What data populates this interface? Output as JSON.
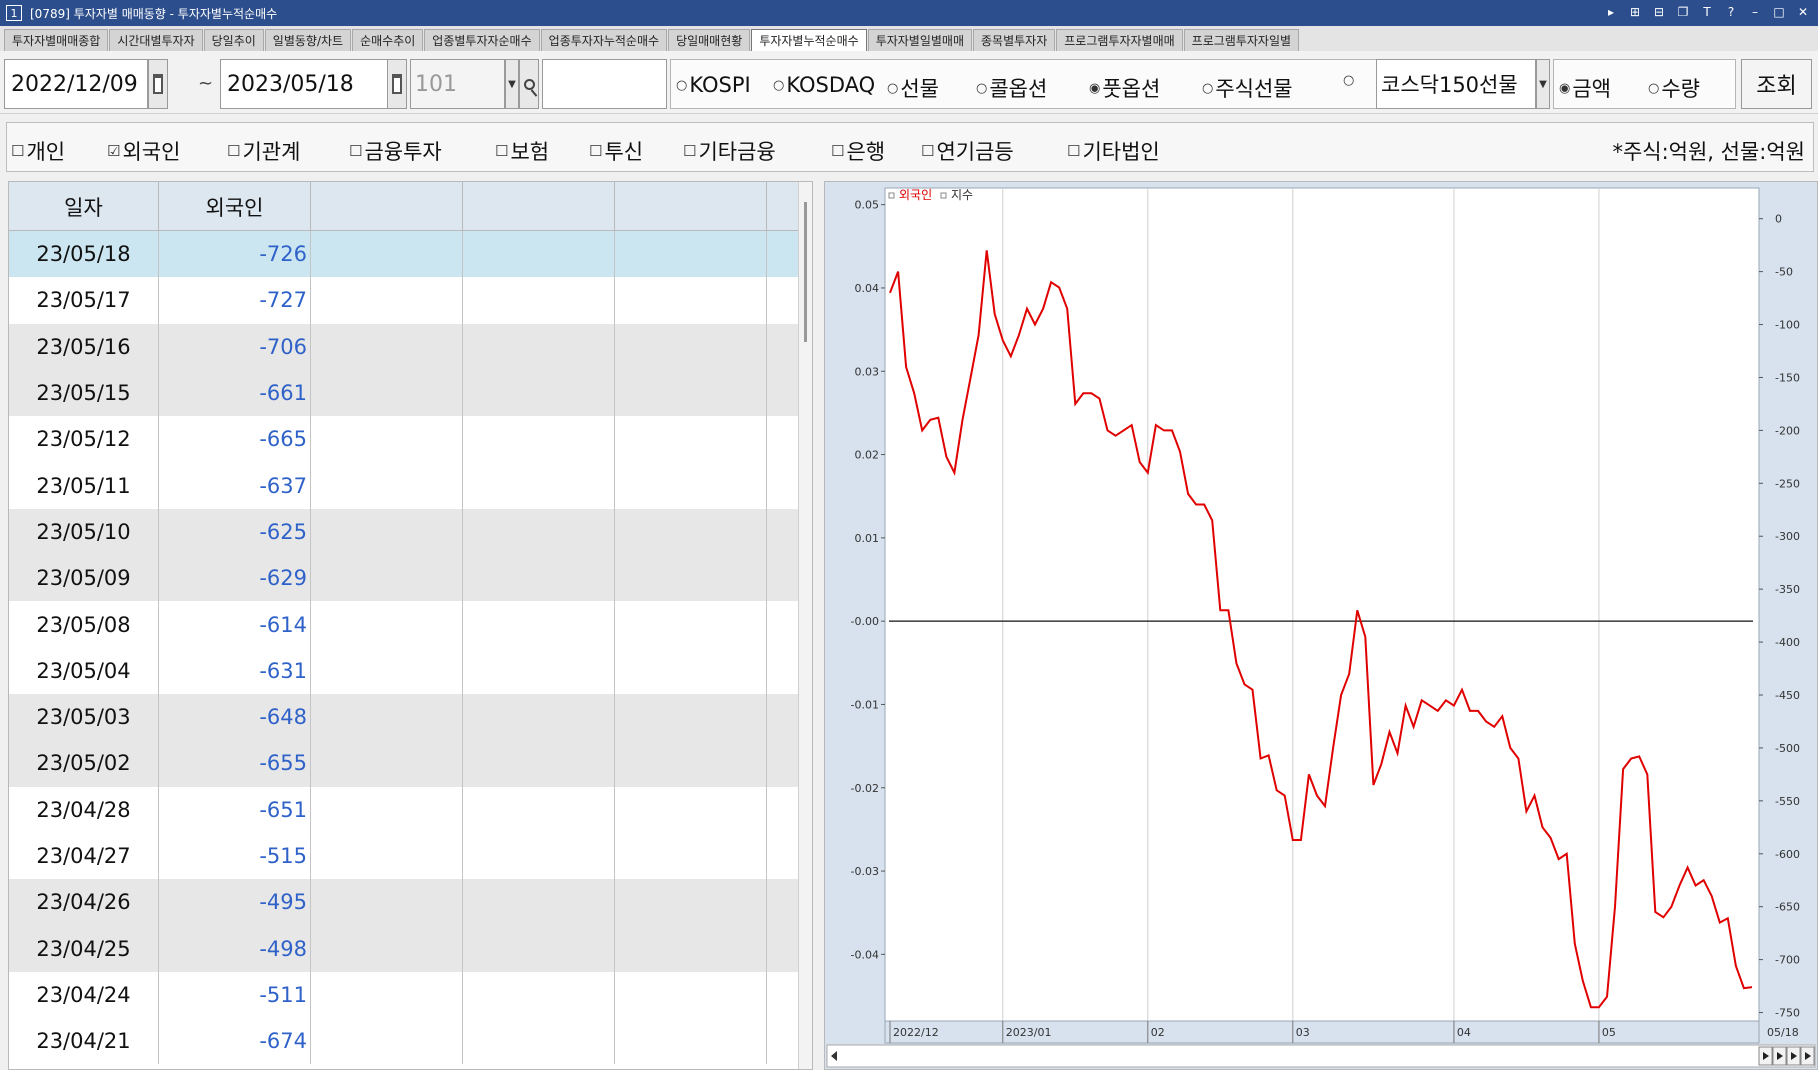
{
  "window": {
    "badge": "1",
    "title": "[0789] 투자자별 매매동향 - 투자자별누적순매수",
    "controls": [
      "▸",
      "⊞",
      "⊟",
      "❐",
      "T",
      "?",
      "–",
      "□",
      "✕"
    ]
  },
  "tabs": [
    {
      "label": "투자자별매매종합",
      "active": false
    },
    {
      "label": "시간대별투자자",
      "active": false
    },
    {
      "label": "당일추이",
      "active": false
    },
    {
      "label": "일별동향/차트",
      "active": false
    },
    {
      "label": "순매수추이",
      "active": false
    },
    {
      "label": "업종별투자자순매수",
      "active": false
    },
    {
      "label": "업종투자자누적순매수",
      "active": false
    },
    {
      "label": "당일매매현황",
      "active": false
    },
    {
      "label": "투자자별누적순매수",
      "active": true
    },
    {
      "label": "투자자별일별매매",
      "active": false
    },
    {
      "label": "종목별투자자",
      "active": false
    },
    {
      "label": "프로그램투자자별매매",
      "active": false
    },
    {
      "label": "프로그램투자자일별",
      "active": false
    }
  ],
  "toolbar": {
    "start_date": "2022/12/09",
    "tilde": "~",
    "end_date": "2023/05/18",
    "code": "101",
    "market_radios": [
      {
        "label": "KOSPI",
        "checked": false
      },
      {
        "label": "KOSDAQ",
        "checked": false
      },
      {
        "label": "선물",
        "checked": false
      },
      {
        "label": "콜옵션",
        "checked": false
      },
      {
        "label": "풋옵션",
        "checked": true
      },
      {
        "label": "주식선물",
        "checked": false
      },
      {
        "label": "",
        "checked": false
      }
    ],
    "product_select": "코스닥150선물",
    "type_radios": [
      {
        "label": "금액",
        "checked": true
      },
      {
        "label": "수량",
        "checked": false
      }
    ],
    "query_label": "조회"
  },
  "investor_checks": [
    {
      "label": "개인",
      "checked": false
    },
    {
      "label": "외국인",
      "checked": true
    },
    {
      "label": "기관계",
      "checked": false
    },
    {
      "label": "금융투자",
      "checked": false
    },
    {
      "label": "보험",
      "checked": false
    },
    {
      "label": "투신",
      "checked": false
    },
    {
      "label": "기타금융",
      "checked": false
    },
    {
      "label": "은행",
      "checked": false
    },
    {
      "label": "연기금등",
      "checked": false
    },
    {
      "label": "기타법인",
      "checked": false
    }
  ],
  "unit_text": "*주식:억원,  선물:억원",
  "grid": {
    "headers": [
      "일자",
      "외국인",
      "",
      "",
      "",
      ""
    ],
    "rows": [
      {
        "date": "23/05/18",
        "value": "-726"
      },
      {
        "date": "23/05/17",
        "value": "-727"
      },
      {
        "date": "23/05/16",
        "value": "-706"
      },
      {
        "date": "23/05/15",
        "value": "-661"
      },
      {
        "date": "23/05/12",
        "value": "-665"
      },
      {
        "date": "23/05/11",
        "value": "-637"
      },
      {
        "date": "23/05/10",
        "value": "-625"
      },
      {
        "date": "23/05/09",
        "value": "-629"
      },
      {
        "date": "23/05/08",
        "value": "-614"
      },
      {
        "date": "23/05/04",
        "value": "-631"
      },
      {
        "date": "23/05/03",
        "value": "-648"
      },
      {
        "date": "23/05/02",
        "value": "-655"
      },
      {
        "date": "23/04/28",
        "value": "-651"
      },
      {
        "date": "23/04/27",
        "value": "-515"
      },
      {
        "date": "23/04/26",
        "value": "-495"
      },
      {
        "date": "23/04/25",
        "value": "-498"
      },
      {
        "date": "23/04/24",
        "value": "-511"
      },
      {
        "date": "23/04/21",
        "value": "-674"
      }
    ]
  },
  "chart_data": {
    "type": "line",
    "legend": [
      {
        "name": "외국인",
        "color": "#e00000"
      },
      {
        "name": "지수",
        "color": "#333333"
      }
    ],
    "left_axis": {
      "ticks": [
        "0.05",
        "0.04",
        "0.03",
        "0.02",
        "0.01",
        "-0.00",
        "-0.01",
        "-0.02",
        "-0.03",
        "-0.04"
      ],
      "range": [
        -0.048,
        0.052
      ]
    },
    "right_axis": {
      "ticks": [
        "0",
        "-50",
        "-100",
        "-150",
        "-200",
        "-250",
        "-300",
        "-350",
        "-400",
        "-450",
        "-500",
        "-550",
        "-600",
        "-650",
        "-700",
        "-750"
      ],
      "range": [
        -758,
        29
      ]
    },
    "x_labels": [
      {
        "label": "2022/12",
        "index": 0
      },
      {
        "label": "2023/01",
        "index": 14
      },
      {
        "label": "02",
        "index": 32
      },
      {
        "label": "03",
        "index": 50
      },
      {
        "label": "04",
        "index": 70
      },
      {
        "label": "05",
        "index": 88
      }
    ],
    "x_end_label": "05/18",
    "zero_line_value": 0,
    "series": [
      {
        "name": "외국인",
        "color": "#e00000",
        "axis": "right",
        "values": [
          -70,
          -50,
          -140,
          -165,
          -200,
          -190,
          -188,
          -225,
          -240,
          -190,
          -150,
          -110,
          -30,
          -90,
          -115,
          -130,
          -110,
          -85,
          -100,
          -85,
          -60,
          -65,
          -85,
          -175,
          -165,
          -165,
          -170,
          -200,
          -205,
          -200,
          -195,
          -230,
          -240,
          -195,
          -200,
          -200,
          -220,
          -260,
          -270,
          -270,
          -285,
          -370,
          -370,
          -420,
          -440,
          -445,
          -510,
          -507,
          -540,
          -545,
          -587,
          -587,
          -525,
          -545,
          -555,
          -500,
          -450,
          -430,
          -370,
          -395,
          -535,
          -515,
          -485,
          -505,
          -460,
          -480,
          -455,
          -460,
          -465,
          -455,
          -460,
          -445,
          -465,
          -465,
          -475,
          -480,
          -470,
          -500,
          -510,
          -560,
          -545,
          -575,
          -585,
          -605,
          -600,
          -685,
          -720,
          -745,
          -745,
          -735,
          -650,
          -520,
          -510,
          -508,
          -525,
          -655,
          -660,
          -650,
          -630,
          -613,
          -630,
          -625,
          -640,
          -665,
          -661,
          -706,
          -727,
          -726
        ]
      }
    ]
  }
}
